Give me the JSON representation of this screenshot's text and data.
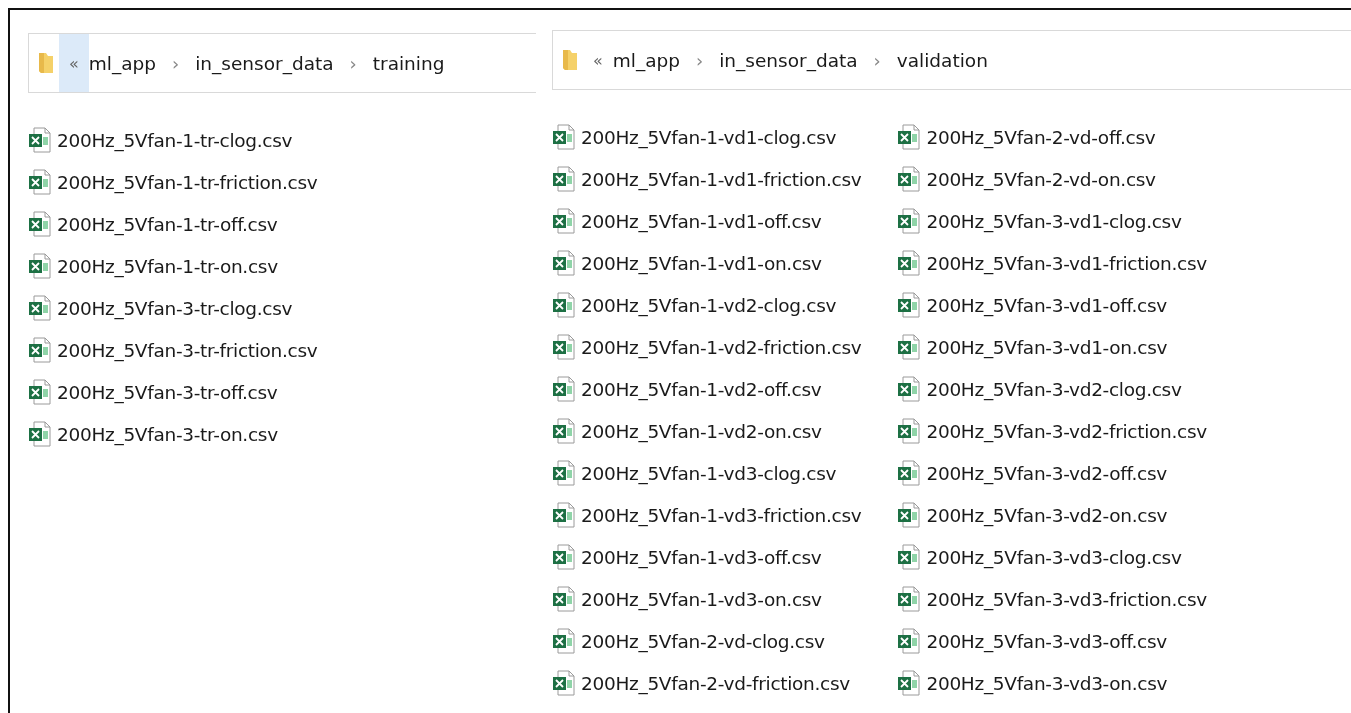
{
  "panes": [
    {
      "breadcrumb": {
        "overflow": "«",
        "overflow_highlighted": true,
        "path": [
          "ml_app",
          "in_sensor_data",
          "training"
        ],
        "separator": "›"
      },
      "files": [
        "200Hz_5Vfan-1-tr-clog.csv",
        "200Hz_5Vfan-1-tr-friction.csv",
        "200Hz_5Vfan-1-tr-off.csv",
        "200Hz_5Vfan-1-tr-on.csv",
        "200Hz_5Vfan-3-tr-clog.csv",
        "200Hz_5Vfan-3-tr-friction.csv",
        "200Hz_5Vfan-3-tr-off.csv",
        "200Hz_5Vfan-3-tr-on.csv"
      ]
    },
    {
      "breadcrumb": {
        "overflow": "«",
        "overflow_highlighted": false,
        "path": [
          "ml_app",
          "in_sensor_data",
          "validation"
        ],
        "separator": "›"
      },
      "files": [
        "200Hz_5Vfan-1-vd1-clog.csv",
        "200Hz_5Vfan-1-vd1-friction.csv",
        "200Hz_5Vfan-1-vd1-off.csv",
        "200Hz_5Vfan-1-vd1-on.csv",
        "200Hz_5Vfan-1-vd2-clog.csv",
        "200Hz_5Vfan-1-vd2-friction.csv",
        "200Hz_5Vfan-1-vd2-off.csv",
        "200Hz_5Vfan-1-vd2-on.csv",
        "200Hz_5Vfan-1-vd3-clog.csv",
        "200Hz_5Vfan-1-vd3-friction.csv",
        "200Hz_5Vfan-1-vd3-off.csv",
        "200Hz_5Vfan-1-vd3-on.csv",
        "200Hz_5Vfan-2-vd-clog.csv",
        "200Hz_5Vfan-2-vd-friction.csv",
        "200Hz_5Vfan-2-vd-off.csv",
        "200Hz_5Vfan-2-vd-on.csv",
        "200Hz_5Vfan-3-vd1-clog.csv",
        "200Hz_5Vfan-3-vd1-friction.csv",
        "200Hz_5Vfan-3-vd1-off.csv",
        "200Hz_5Vfan-3-vd1-on.csv",
        "200Hz_5Vfan-3-vd2-clog.csv",
        "200Hz_5Vfan-3-vd2-friction.csv",
        "200Hz_5Vfan-3-vd2-off.csv",
        "200Hz_5Vfan-3-vd2-on.csv",
        "200Hz_5Vfan-3-vd3-clog.csv",
        "200Hz_5Vfan-3-vd3-friction.csv",
        "200Hz_5Vfan-3-vd3-off.csv",
        "200Hz_5Vfan-3-vd3-on.csv"
      ]
    }
  ]
}
